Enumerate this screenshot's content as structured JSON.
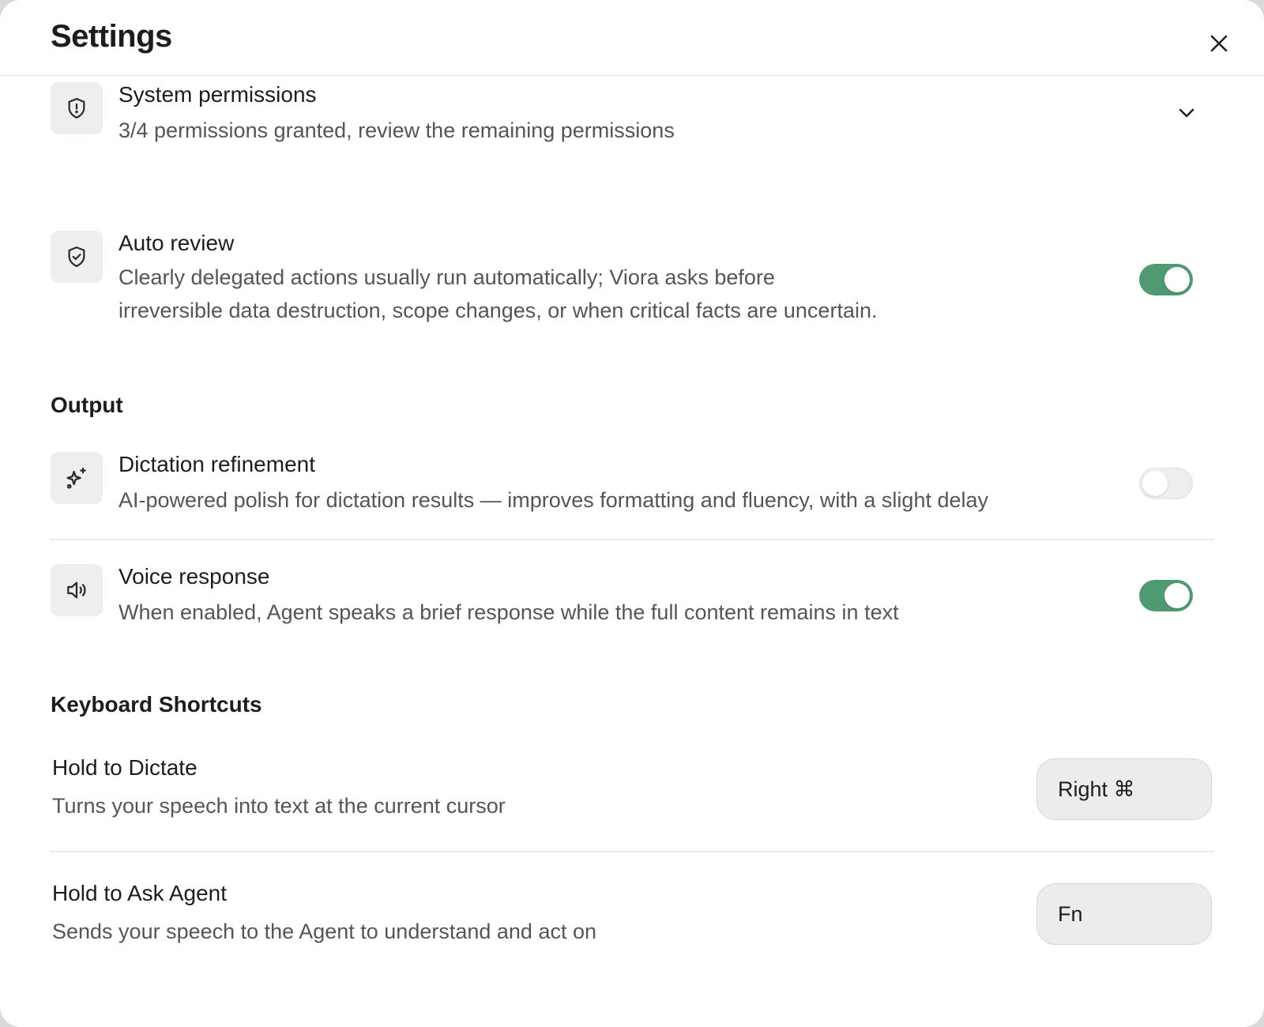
{
  "title": "Settings",
  "colors": {
    "toggle_on": "#4f9a72",
    "icon_tile": "#f0eeec"
  },
  "permissions": {
    "icon": "shield-alert-icon",
    "title": "System permissions",
    "description": "3/4 permissions granted, review the remaining permissions",
    "expanded": false
  },
  "auto_review": {
    "icon": "shield-check-icon",
    "title": "Auto review",
    "description_line1": "Clearly delegated actions usually run automatically; Viora asks before",
    "description_line2": "irreversible data destruction, scope changes, or when critical facts are uncertain.",
    "enabled": true
  },
  "output": {
    "heading": "Output",
    "dictation_refinement": {
      "icon": "sparkles-icon",
      "title": "Dictation refinement",
      "description": "AI-powered polish for dictation results — improves formatting and fluency, with a slight delay",
      "enabled": false
    },
    "voice_response": {
      "icon": "speaker-icon",
      "title": "Voice response",
      "description": "When enabled, Agent speaks a brief response while the full content remains in text",
      "enabled": true
    }
  },
  "shortcuts": {
    "heading": "Keyboard Shortcuts",
    "dictate": {
      "title": "Hold to Dictate",
      "description": "Turns your speech into text at the current cursor",
      "key": "Right ⌘"
    },
    "ask_agent": {
      "title": "Hold to Ask Agent",
      "description": "Sends your speech to the Agent to understand and act on",
      "key": "Fn"
    }
  }
}
